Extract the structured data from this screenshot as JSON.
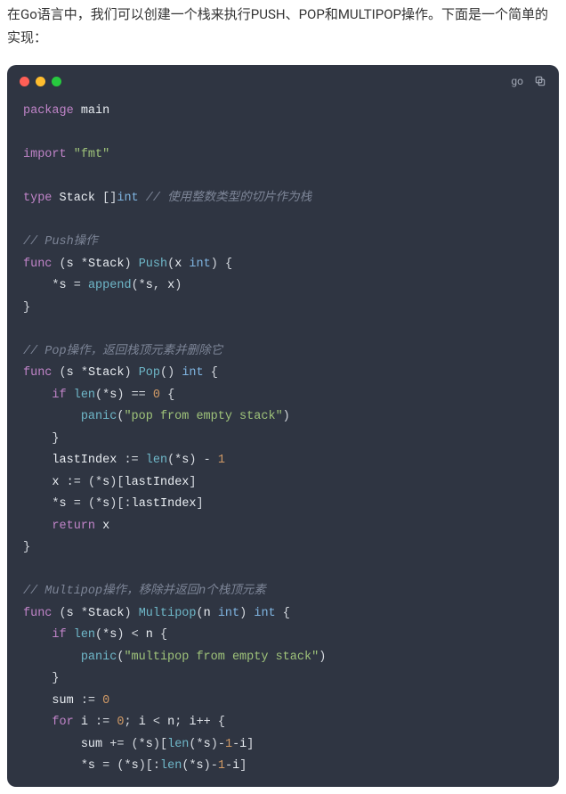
{
  "intro": "在Go语言中，我们可以创建一个栈来执行PUSH、POP和MULTIPOP操作。下面是一个简单的实现：",
  "header": {
    "lang": "go"
  },
  "t": {
    "package": "package",
    "main": "main",
    "import": "import",
    "fmt_str": "\"fmt\"",
    "type": "type",
    "Stack": "Stack",
    "int": "int",
    "cmt_stack": "// 使用整数类型的切片作为栈",
    "cmt_push": "// Push操作",
    "func": "func",
    "s": "s",
    "star": "*",
    "Push": "Push",
    "x": "x",
    "lbrace": "{",
    "rbrace": "}",
    "lparen": "(",
    "rparen": ")",
    "lbr": "[",
    "rbr": "]",
    "eq": "=",
    "append": "append",
    "comma": ",",
    "cmt_pop": "// Pop操作，返回栈顶元素并删除它",
    "Pop": "Pop",
    "if": "if",
    "len": "len",
    "eqeq": "==",
    "zero": "0",
    "panic": "panic",
    "pop_err": "\"pop from empty stack\"",
    "lastIndex": "lastIndex",
    "decl": ":=",
    "minus": "-",
    "one": "1",
    "colon": ":",
    "return": "return",
    "cmt_multi": "// Multipop操作，移除并返回n个栈顶元素",
    "Multipop": "Multipop",
    "n": "n",
    "lt": "<",
    "multi_err": "\"multipop from empty stack\"",
    "sum": "sum",
    "for": "for",
    "i": "i",
    "semi": ";",
    "pp": "++",
    "pluseq": "+="
  }
}
